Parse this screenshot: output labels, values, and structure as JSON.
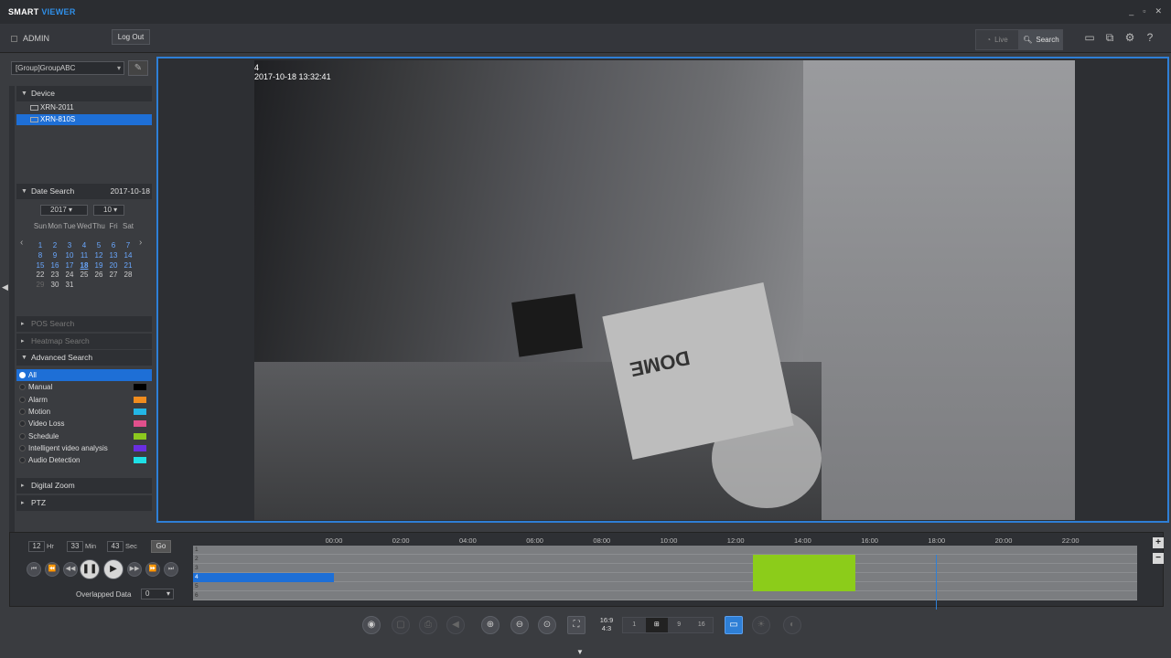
{
  "app": {
    "title_prefix": "SMART",
    "title_suffix": "VIEWER",
    "win_min": "_",
    "win_restore": "▫",
    "win_close": "✕"
  },
  "topbar": {
    "user": "ADMIN",
    "logout": "Log Out",
    "mode_live": "Live",
    "mode_search": "Search"
  },
  "sidebar": {
    "group_select": "[Group]GroupABC",
    "device_header": "Device",
    "devices": [
      "XRN-2011",
      "XRN-810S"
    ],
    "date_header": "Date Search",
    "date_value": "2017-10-18",
    "year": "2017",
    "month": "10",
    "weekdays": [
      "Sun",
      "Mon",
      "Tue",
      "Wed",
      "Thu",
      "Fri",
      "Sat"
    ],
    "calendar": [
      [
        "",
        "",
        "",
        "",
        "",
        "",
        ""
      ],
      [
        "1",
        "2",
        "3",
        "4",
        "5",
        "6",
        "7"
      ],
      [
        "8",
        "9",
        "10",
        "11",
        "12",
        "13",
        "14"
      ],
      [
        "15",
        "16",
        "17",
        "18",
        "19",
        "20",
        "21"
      ],
      [
        "22",
        "23",
        "24",
        "25",
        "26",
        "27",
        "28"
      ],
      [
        "29",
        "30",
        "31",
        "",
        "",
        "",
        ""
      ]
    ],
    "pos_search": "POS Search",
    "heatmap_search": "Heatmap Search",
    "advanced_header": "Advanced Search",
    "events": [
      {
        "label": "All",
        "color": ""
      },
      {
        "label": "Manual",
        "color": "#000000"
      },
      {
        "label": "Alarm",
        "color": "#f08c1e"
      },
      {
        "label": "Motion",
        "color": "#23b6e6"
      },
      {
        "label": "Video Loss",
        "color": "#e0508c"
      },
      {
        "label": "Schedule",
        "color": "#8cc81e"
      },
      {
        "label": "Intelligent video analysis",
        "color": "#6a2ee0"
      },
      {
        "label": "Audio Detection",
        "color": "#1ee0e6"
      }
    ],
    "digital_zoom": "Digital Zoom",
    "ptz": "PTZ"
  },
  "video": {
    "channel": "4",
    "timestamp": "2017-10-18 13:32:41",
    "box_text": "DOME"
  },
  "playback": {
    "hr": "12",
    "hr_unit": "Hr",
    "min": "33",
    "min_unit": "Min",
    "sec": "43",
    "sec_unit": "Sec",
    "go": "Go",
    "overlapped_label": "Overlapped Data",
    "overlapped_value": "0",
    "hours": [
      "00:00",
      "02:00",
      "04:00",
      "06:00",
      "08:00",
      "10:00",
      "12:00",
      "14:00",
      "16:00",
      "18:00",
      "20:00",
      "22:00"
    ],
    "rows": [
      "1",
      "2",
      "3",
      "4",
      "5",
      "6"
    ]
  },
  "toolbar": {
    "ratio_top": "16:9",
    "ratio_bottom": "4:3",
    "split1": "1",
    "split4": "4",
    "split9": "9",
    "split16": "16"
  }
}
